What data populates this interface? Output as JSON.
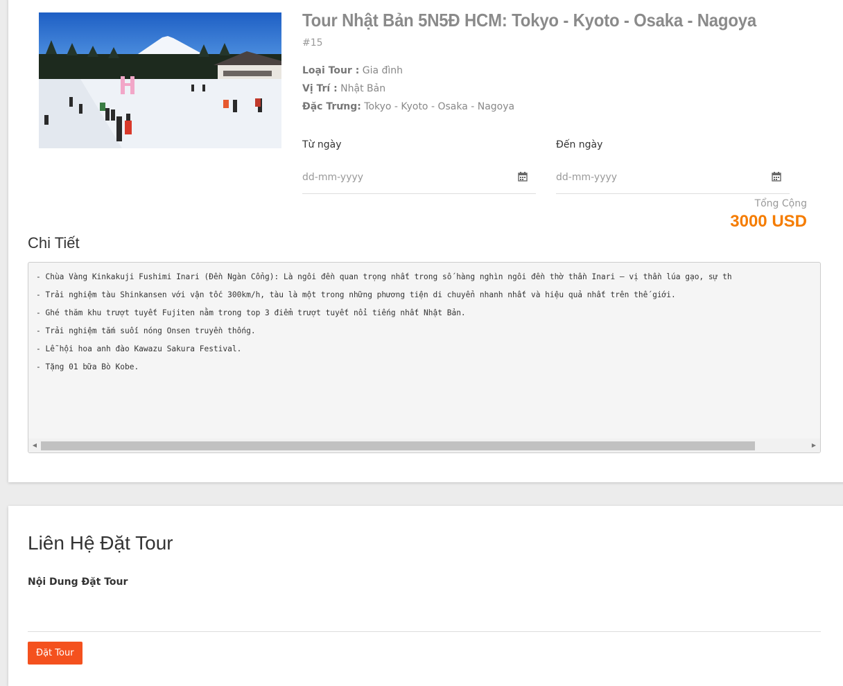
{
  "tour": {
    "title": "Tour Nhật Bản 5N5Đ HCM: Tokyo - Kyoto - Osaka - Nagoya",
    "code": "#15",
    "type_label": "Loại Tour :",
    "type_value": "Gia đình",
    "location_label": "Vị Trí :",
    "location_value": "Nhật Bản",
    "feature_label": "Đặc Trưng:",
    "feature_value": "Tokyo - Kyoto - Osaka - Nagoya",
    "image_icon": "ski-resort-photo"
  },
  "dates": {
    "from_label": "Từ ngày",
    "from_placeholder": "dd-mm-yyyy",
    "to_label": "Đến ngày",
    "to_placeholder": "dd-mm-yyyy",
    "icon": "calendar-icon"
  },
  "price": {
    "total_label": "Tổng Cộng",
    "total_value": "3000 USD",
    "accent_color": "#f57c00"
  },
  "details": {
    "heading": "Chi Tiết",
    "lines": [
      "- Chùa Vàng Kinkakuji Fushimi Inari (Đền Ngàn Cổng): Là ngôi đền quan trọng nhất trong số hàng nghìn ngôi đền thờ thần Inari – vị thần lúa gạo, sự th",
      "- Trải nghiệm tàu Shinkansen với vận tốc 300km/h, tàu là một trong những phương tiện di chuyển nhanh nhất và hiệu quả nhất trên thế giới.",
      "- Ghé thăm khu trượt tuyết Fujiten nằm trong top 3 điểm trượt tuyết nổi tiếng nhất Nhật Bản.",
      "- Trải nghiệm tắm suối nóng Onsen truyền thống.",
      "- Lễ hội hoa anh đào Kawazu Sakura Festival.",
      "- Tặng 01 bữa Bò Kobe."
    ]
  },
  "booking": {
    "heading": "Liên Hệ Đặt Tour",
    "content_label": "Nội Dung Đặt Tour",
    "content_value": "",
    "submit_label": "Đặt Tour",
    "button_color": "#f4511e"
  }
}
